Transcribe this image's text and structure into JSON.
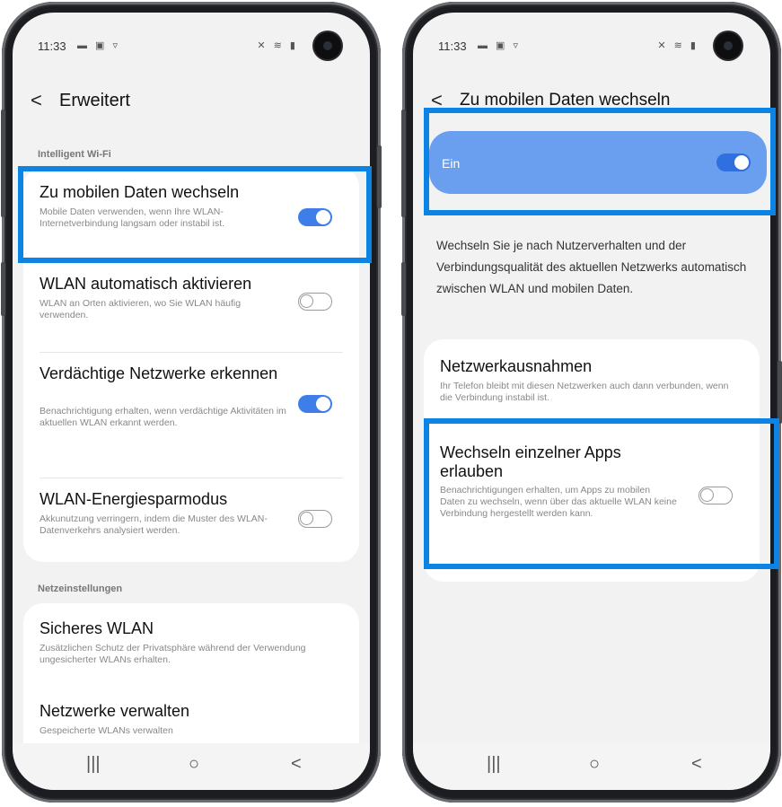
{
  "left": {
    "status": {
      "time": "11:33",
      "notif_icons": "▬ ▣ ▿",
      "right_icons": "✕ ≋ ▮"
    },
    "title": "Erweitert",
    "section1": "Intelligent Wi-Fi",
    "items": [
      {
        "title": "Zu mobilen Daten wechseln",
        "desc": "Mobile Daten verwenden, wenn Ihre WLAN-Internetverbindung langsam oder instabil ist.",
        "toggle": true
      },
      {
        "title": "WLAN automatisch aktivieren",
        "desc": "WLAN an Orten aktivieren, wo Sie WLAN häufig verwenden.",
        "toggle": false
      },
      {
        "title": "Verdächtige Netzwerke erkennen",
        "desc": "Benachrichtigung erhalten, wenn verdächtige Aktivitäten im aktuellen WLAN erkannt werden.",
        "toggle": true
      },
      {
        "title": "WLAN-Energiesparmodus",
        "desc": "Akkunutzung verringern, indem die Muster des WLAN-Datenverkehrs analysiert werden.",
        "toggle": false
      }
    ],
    "section2": "Netzeinstellungen",
    "items2": [
      {
        "title": "Sicheres WLAN",
        "desc": "Zusätzlichen Schutz der Privatsphäre während der Verwendung ungesicherter WLANs erhalten."
      },
      {
        "title": "Netzwerke verwalten",
        "desc": "Gespeicherte WLANs verwalten"
      }
    ],
    "nav": {
      "recent": "|||",
      "home": "○",
      "back": "<"
    }
  },
  "right": {
    "status": {
      "time": "11:33",
      "notif_icons": "▬ ▣ ▿",
      "right_icons": "✕ ≋ ▮"
    },
    "title": "Zu mobilen Daten wechseln",
    "master_label": "Ein",
    "master_toggle": true,
    "description": "Wechseln Sie je nach Nutzerverhalten und der Verbindungsqualität des aktuellen Netzwerks automatisch zwischen WLAN und mobilen Daten.",
    "items": [
      {
        "title": "Netzwerkausnahmen",
        "desc": "Ihr Telefon bleibt mit diesen Netzwerken auch dann verbunden, wenn die Verbindung instabil ist."
      },
      {
        "title": "Wechseln einzelner Apps erlauben",
        "desc": "Benachrichtigungen erhalten, um Apps zu mobilen Daten zu wechseln, wenn über das aktuelle WLAN keine Verbindung hergestellt werden kann.",
        "toggle": false
      }
    ],
    "nav": {
      "recent": "|||",
      "home": "○",
      "back": "<"
    }
  },
  "colors": {
    "highlight": "#0b84e6",
    "toggle_on": "#3e7ee8",
    "ein_bar": "#6a9ff0"
  }
}
